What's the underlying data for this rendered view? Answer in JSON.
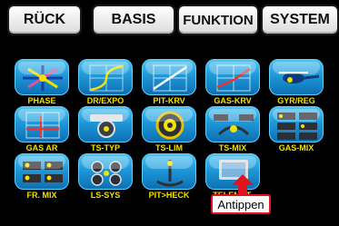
{
  "tabs": [
    {
      "label": "RÜCK"
    },
    {
      "label": "BASIS"
    },
    {
      "label": "FUNKTION"
    },
    {
      "label": "SYSTEM"
    }
  ],
  "menu": {
    "items": [
      {
        "label": "PHASE",
        "icon": "phase-icon"
      },
      {
        "label": "DR/EXPO",
        "icon": "dr-expo-icon"
      },
      {
        "label": "PIT-KRV",
        "icon": "pitch-curve-icon"
      },
      {
        "label": "GAS-KRV",
        "icon": "throttle-curve-icon"
      },
      {
        "label": "GYR/REG",
        "icon": "gyro-governor-icon"
      },
      {
        "label": "GAS AR",
        "icon": "throttle-ar-icon"
      },
      {
        "label": "TS-TYP",
        "icon": "swashplate-type-icon"
      },
      {
        "label": "TS-LIM",
        "icon": "swashplate-limit-icon"
      },
      {
        "label": "TS-MIX",
        "icon": "swashplate-mix-icon"
      },
      {
        "label": "GAS-MIX",
        "icon": "throttle-mix-icon"
      },
      {
        "label": "FR. MIX",
        "icon": "free-mix-icon"
      },
      {
        "label": "LS-SYS",
        "icon": "logic-switch-icon"
      },
      {
        "label": "PIT>HECK",
        "icon": "pitch-to-tail-icon"
      },
      {
        "label": "TELEMET.",
        "icon": "telemetry-icon"
      }
    ]
  },
  "callout": {
    "label": "Antippen"
  },
  "colors": {
    "label": "#f2e200",
    "tile": "#1f98d8",
    "callout_border": "#e0141e"
  }
}
